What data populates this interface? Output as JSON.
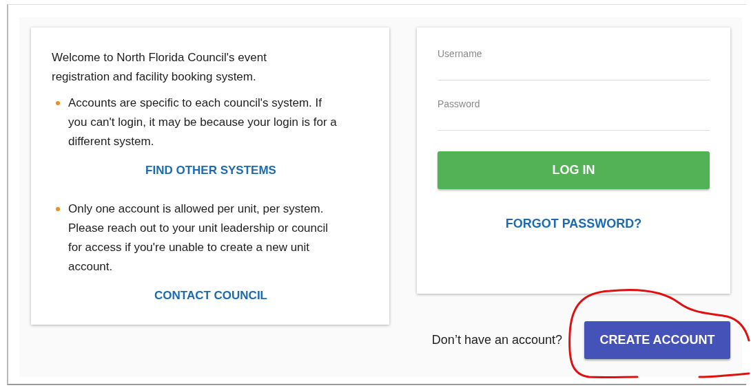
{
  "intro": "Welcome to North Florida Council's event registration and facility booking system.",
  "notes": [
    {
      "text": "Accounts are specific to each council's system. If you can't login, it may be because your login is for a different system.",
      "link": "FIND OTHER SYSTEMS"
    },
    {
      "text": "Only one account is allowed per unit, per system. Please reach out to your unit leadership or council for access if you're unable to create a new unit account.",
      "link": "CONTACT COUNCIL"
    }
  ],
  "login": {
    "fields": [
      {
        "placeholder": "Username"
      },
      {
        "placeholder": "Password"
      }
    ],
    "submit": "LOG IN",
    "forgot": "FORGOT PASSWORD?"
  },
  "signup": {
    "prompt": "Don’t have an account?",
    "button": "CREATE ACCOUNT"
  }
}
